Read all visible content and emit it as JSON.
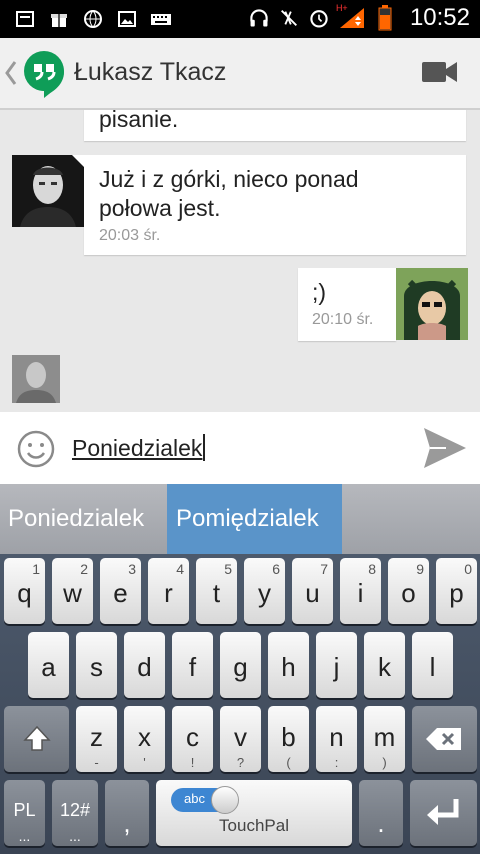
{
  "status_bar": {
    "time": "10:52",
    "network_label": "H+",
    "left_icons": [
      "sd-card-icon",
      "gift-icon",
      "globe-icon",
      "image-icon",
      "keyboard-icon"
    ],
    "right_icons": [
      "headphones-icon",
      "mute-icon",
      "alarm-icon",
      "signal-icon",
      "battery-icon"
    ]
  },
  "header": {
    "contact_name": "Łukasz Tkacz"
  },
  "chat": {
    "messages": [
      {
        "text": "pisanie.",
        "time": ""
      },
      {
        "text": "Już i z górki, nieco ponad połowa jest.",
        "time": "20:03 śr."
      },
      {
        "text": ";)",
        "time": "20:10 śr."
      }
    ]
  },
  "compose": {
    "text": "Poniedzialek"
  },
  "suggestions": [
    "Poniedzialek",
    "Pomiędzialek"
  ],
  "keyboard": {
    "row1": [
      {
        "k": "q",
        "n": "1"
      },
      {
        "k": "w",
        "n": "2"
      },
      {
        "k": "e",
        "n": "3"
      },
      {
        "k": "r",
        "n": "4"
      },
      {
        "k": "t",
        "n": "5"
      },
      {
        "k": "y",
        "n": "6"
      },
      {
        "k": "u",
        "n": "7"
      },
      {
        "k": "i",
        "n": "8"
      },
      {
        "k": "o",
        "n": "9"
      },
      {
        "k": "p",
        "n": "0"
      }
    ],
    "row2": [
      "a",
      "s",
      "d",
      "f",
      "g",
      "h",
      "j",
      "k",
      "l"
    ],
    "row3": [
      {
        "k": "z",
        "s": "-"
      },
      {
        "k": "x",
        "s": "'"
      },
      {
        "k": "c",
        "s": "!"
      },
      {
        "k": "v",
        "s": "?"
      },
      {
        "k": "b",
        "s": "("
      },
      {
        "k": "n",
        "s": ":"
      },
      {
        "k": "m",
        "s": ")"
      }
    ],
    "lang_key": "PL",
    "symbols_key": "12#",
    "comma_key": ",",
    "period_key": ".",
    "toggle_label": "abc",
    "space_label": "TouchPal",
    "ellipsis": "..."
  },
  "colors": {
    "header_bg": "#f0f0f0",
    "chat_bg": "#e8e8e8",
    "hangouts_green": "#0f9d58",
    "suggestion_highlight": "#5a94c9",
    "keyboard_bg": "#4d5a6c"
  }
}
